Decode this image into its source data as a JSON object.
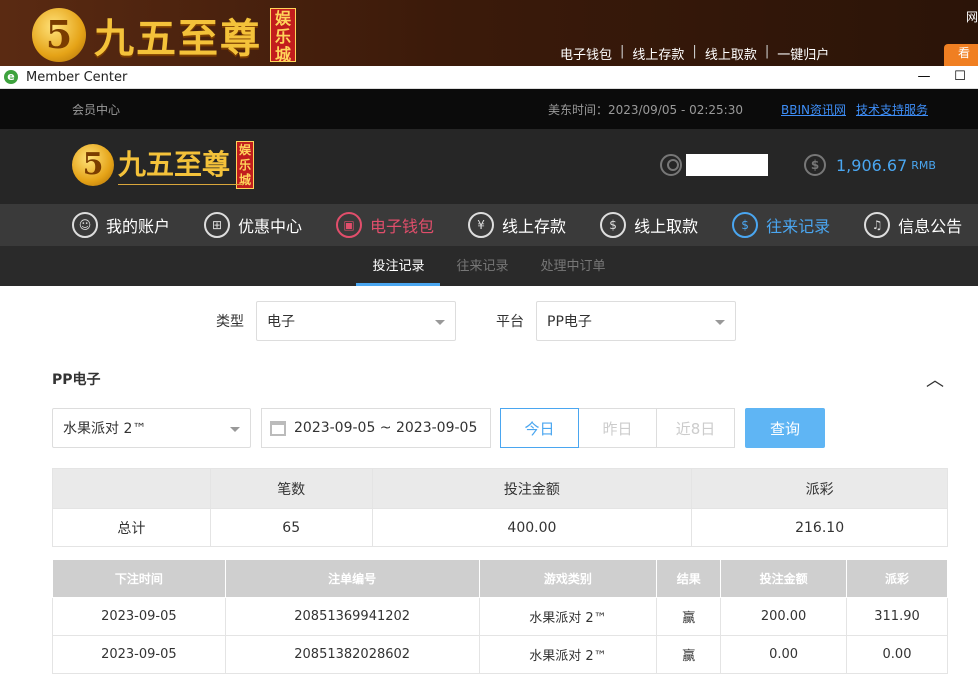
{
  "site": {
    "logo_mark": "5",
    "logo_text": "九五至尊",
    "logo_badge": "娱乐城",
    "nav": [
      "电子钱包",
      "线上存款",
      "线上取款",
      "一键归户"
    ],
    "right_label": "网",
    "orange_label": "看"
  },
  "window": {
    "title": "Member Center",
    "controls": {
      "minimize": "—",
      "maximize": "☐"
    }
  },
  "topbar": {
    "member_center": "会员中心",
    "time": "美东时间：2023/09/05 - 02:25:30",
    "link1": "BBIN资讯网",
    "link2": "技术支持服务"
  },
  "header": {
    "logo_mark": "5",
    "logo_text": "九五至尊",
    "logo_badge": "娱乐城",
    "coin_symbol": "$",
    "balance": "1,906.67",
    "currency": "RMB"
  },
  "mainnav": [
    {
      "label": "我的账户",
      "icon": "user-icon"
    },
    {
      "label": "优惠中心",
      "icon": "gift-icon"
    },
    {
      "label": "电子钱包",
      "icon": "wallet-icon"
    },
    {
      "label": "线上存款",
      "icon": "deposit-icon"
    },
    {
      "label": "线上取款",
      "icon": "withdraw-icon"
    },
    {
      "label": "往来记录",
      "icon": "records-icon"
    },
    {
      "label": "信息公告",
      "icon": "bell-icon"
    }
  ],
  "subnav": [
    "投注记录",
    "往来记录",
    "处理中订单"
  ],
  "filters": {
    "type_label": "类型",
    "type_value": "电子",
    "platform_label": "平台",
    "platform_value": "PP电子"
  },
  "section": {
    "title": "PP电子",
    "collapse": "︿"
  },
  "query": {
    "game": "水果派对 2™",
    "date_range": "2023-09-05 ~ 2023-09-05",
    "today": "今日",
    "yesterday": "昨日",
    "last8": "近8日",
    "submit": "查询"
  },
  "summary": {
    "headers": [
      "",
      "笔数",
      "投注金额",
      "派彩"
    ],
    "row": [
      "总计",
      "65",
      "400.00",
      "216.10"
    ]
  },
  "records": {
    "headers": [
      "下注时间",
      "注单编号",
      "游戏类别",
      "结果",
      "投注金额",
      "派彩"
    ],
    "rows": [
      [
        "2023-09-05",
        "20851369941202",
        "水果派对 2™",
        "赢",
        "200.00",
        "311.90"
      ],
      [
        "2023-09-05",
        "20851382028602",
        "水果派对 2™",
        "赢",
        "0.00",
        "0.00"
      ]
    ]
  }
}
